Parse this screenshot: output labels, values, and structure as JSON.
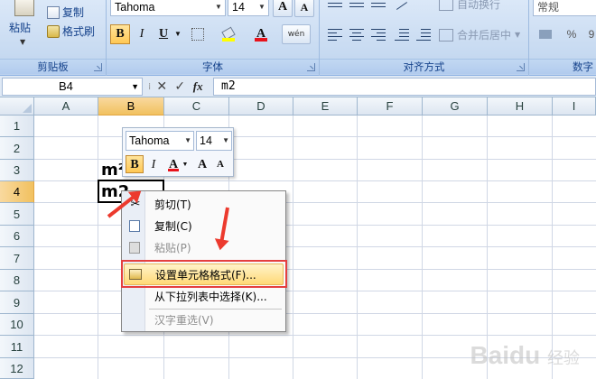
{
  "ribbon": {
    "clipboard": {
      "paste_label": "粘贴",
      "copy_label": "复制",
      "format_painter_label": "格式刷",
      "group_label": "剪贴板"
    },
    "font": {
      "font_name": "Tahoma",
      "font_size": "14",
      "grow_label": "A",
      "shrink_label": "A",
      "bold_label": "B",
      "italic_label": "I",
      "underline_label": "U",
      "font_color_label": "A",
      "phonetic_label": "wén",
      "group_label": "字体"
    },
    "alignment": {
      "wrap_label": "自动换行",
      "merge_label": "合并后居中",
      "group_label": "对齐方式"
    },
    "number": {
      "format_value": "常规",
      "percent_label": "%",
      "comma_label": "9",
      "group_label": "数字"
    }
  },
  "formula_bar": {
    "name_box": "B4",
    "fx_label": "fx",
    "cancel_label": "✕",
    "enter_label": "✓",
    "content": "m2"
  },
  "grid": {
    "columns": [
      "A",
      "B",
      "C",
      "D",
      "E",
      "F",
      "G",
      "H",
      "I"
    ],
    "rows": [
      "1",
      "2",
      "3",
      "4",
      "5",
      "6",
      "7",
      "8",
      "9",
      "10",
      "11",
      "12"
    ],
    "selected_column": "B",
    "selected_row": "4",
    "cells": {
      "B3": "m²",
      "B4": "m2"
    }
  },
  "mini_toolbar": {
    "font_name": "Tahoma",
    "font_size": "14",
    "bold_label": "B",
    "italic_label": "I",
    "font_color_label": "A",
    "grow_label": "A",
    "shrink_label": "A"
  },
  "context_menu": {
    "items": [
      {
        "label": "剪切(T)",
        "icon": "scissors-icon",
        "enabled": true
      },
      {
        "label": "复制(C)",
        "icon": "copy-icon",
        "enabled": true
      },
      {
        "label": "粘贴(P)",
        "icon": "paste-icon",
        "enabled": false
      },
      {
        "label": "设置单元格格式(F)...",
        "icon": "format-cells-icon",
        "enabled": true,
        "highlighted": true
      },
      {
        "label": "从下拉列表中选择(K)...",
        "enabled": true
      },
      {
        "label": "汉字重选(V)",
        "enabled": false
      }
    ]
  },
  "annotation": {
    "highlight_color": "#e53f3f",
    "arrow_color": "#ec3a2e"
  },
  "watermark": {
    "text": "Baidu",
    "sub": "经验"
  }
}
